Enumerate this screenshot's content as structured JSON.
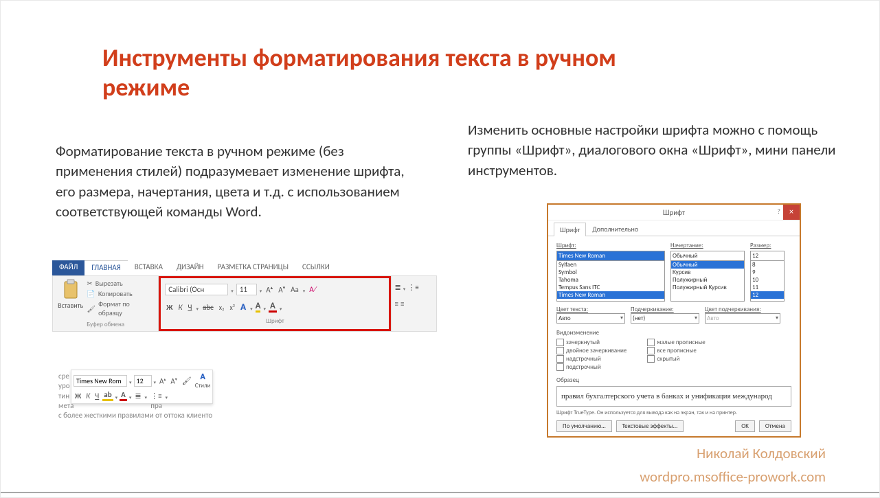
{
  "title": "Инструменты форматирования текста в ручном режиме",
  "para_left": "Форматирование текста в ручном режиме (без применения стилей) подразумевает изменение шрифта, его размера, начертания, цвета и т.д. с использованием соответствующей команды Word.",
  "para_right": "Изменить основные настройки шрифта можно с помощь группы «Шрифт», диалогового окна «Шрифт», мини панели инструментов.",
  "ribbon": {
    "tabs": {
      "file": "ФАЙЛ",
      "home": "ГЛАВНАЯ",
      "insert": "ВСТАВКА",
      "design": "ДИЗАЙН",
      "layout": "РАЗМЕТКА СТРАНИЦЫ",
      "refs": "ССЫЛКИ"
    },
    "clipboard": {
      "paste": "Вставить",
      "cut": "Вырезать",
      "copy": "Копировать",
      "format": "Формат по образцу",
      "group": "Буфер обмена"
    },
    "font": {
      "name": "Calibri (Осн",
      "size": "11",
      "bigger": "Aˆ",
      "smaller": "Aˇ",
      "changecase": "Aa",
      "clear": "✎",
      "bold": "Ж",
      "italic": "К",
      "underline": "Ч",
      "strike": "abc",
      "sub": "x₂",
      "sup": "x²",
      "effects": "A",
      "highlight": "A",
      "color": "A",
      "group": "Шрифт"
    }
  },
  "minitb": {
    "name": "Times New Rom",
    "size": "12",
    "bold": "Ж",
    "italic": "К",
    "underline": "Ч",
    "styles": "Стили",
    "blurb": "с более жесткими правилами от оттока клиенто"
  },
  "dialog": {
    "title": "Шрифт",
    "tabs": {
      "font": "Шрифт",
      "adv": "Дополнительно"
    },
    "labels": {
      "font": "Шрифт:",
      "style": "Начертание:",
      "size": "Размер:",
      "fgcolor": "Цвет текста:",
      "under": "Подчеркивание:",
      "undercolor": "Цвет подчеркивания:"
    },
    "font_value": "Times New Roman",
    "font_list": [
      "Sylfaen",
      "Symbol",
      "Tahoma",
      "Tempus Sans ITC",
      "Times New Roman"
    ],
    "style_value": "Обычный",
    "style_list": [
      "Обычный",
      "Курсив",
      "Полужирный",
      "Полужирный Курсив"
    ],
    "size_value": "12",
    "size_list": [
      "8",
      "9",
      "10",
      "11",
      "12"
    ],
    "auto": "Авто",
    "none": "(нет)",
    "effects_head": "Видоизменение",
    "effects": {
      "strike": "зачеркнутый",
      "dstrike": "двойное зачеркивание",
      "supers": "надстрочный",
      "subs": "подстрочный",
      "smallcaps": "малые прописные",
      "allcaps": "все прописные",
      "hidden": "скрытый"
    },
    "preview_head": "Образец",
    "preview": "правил бухгалтерского учета в банках и унификация международ",
    "note": "Шрифт TrueType. Он используется для вывода как на экран, так и на принтер.",
    "buttons": {
      "default": "По умолчанию…",
      "texteff": "Текстовые эффекты…",
      "ok": "OK",
      "cancel": "Отмена"
    }
  },
  "footer": {
    "author": "Николай Колдовский",
    "url": "wordpro.msoffice-prowork.com"
  }
}
